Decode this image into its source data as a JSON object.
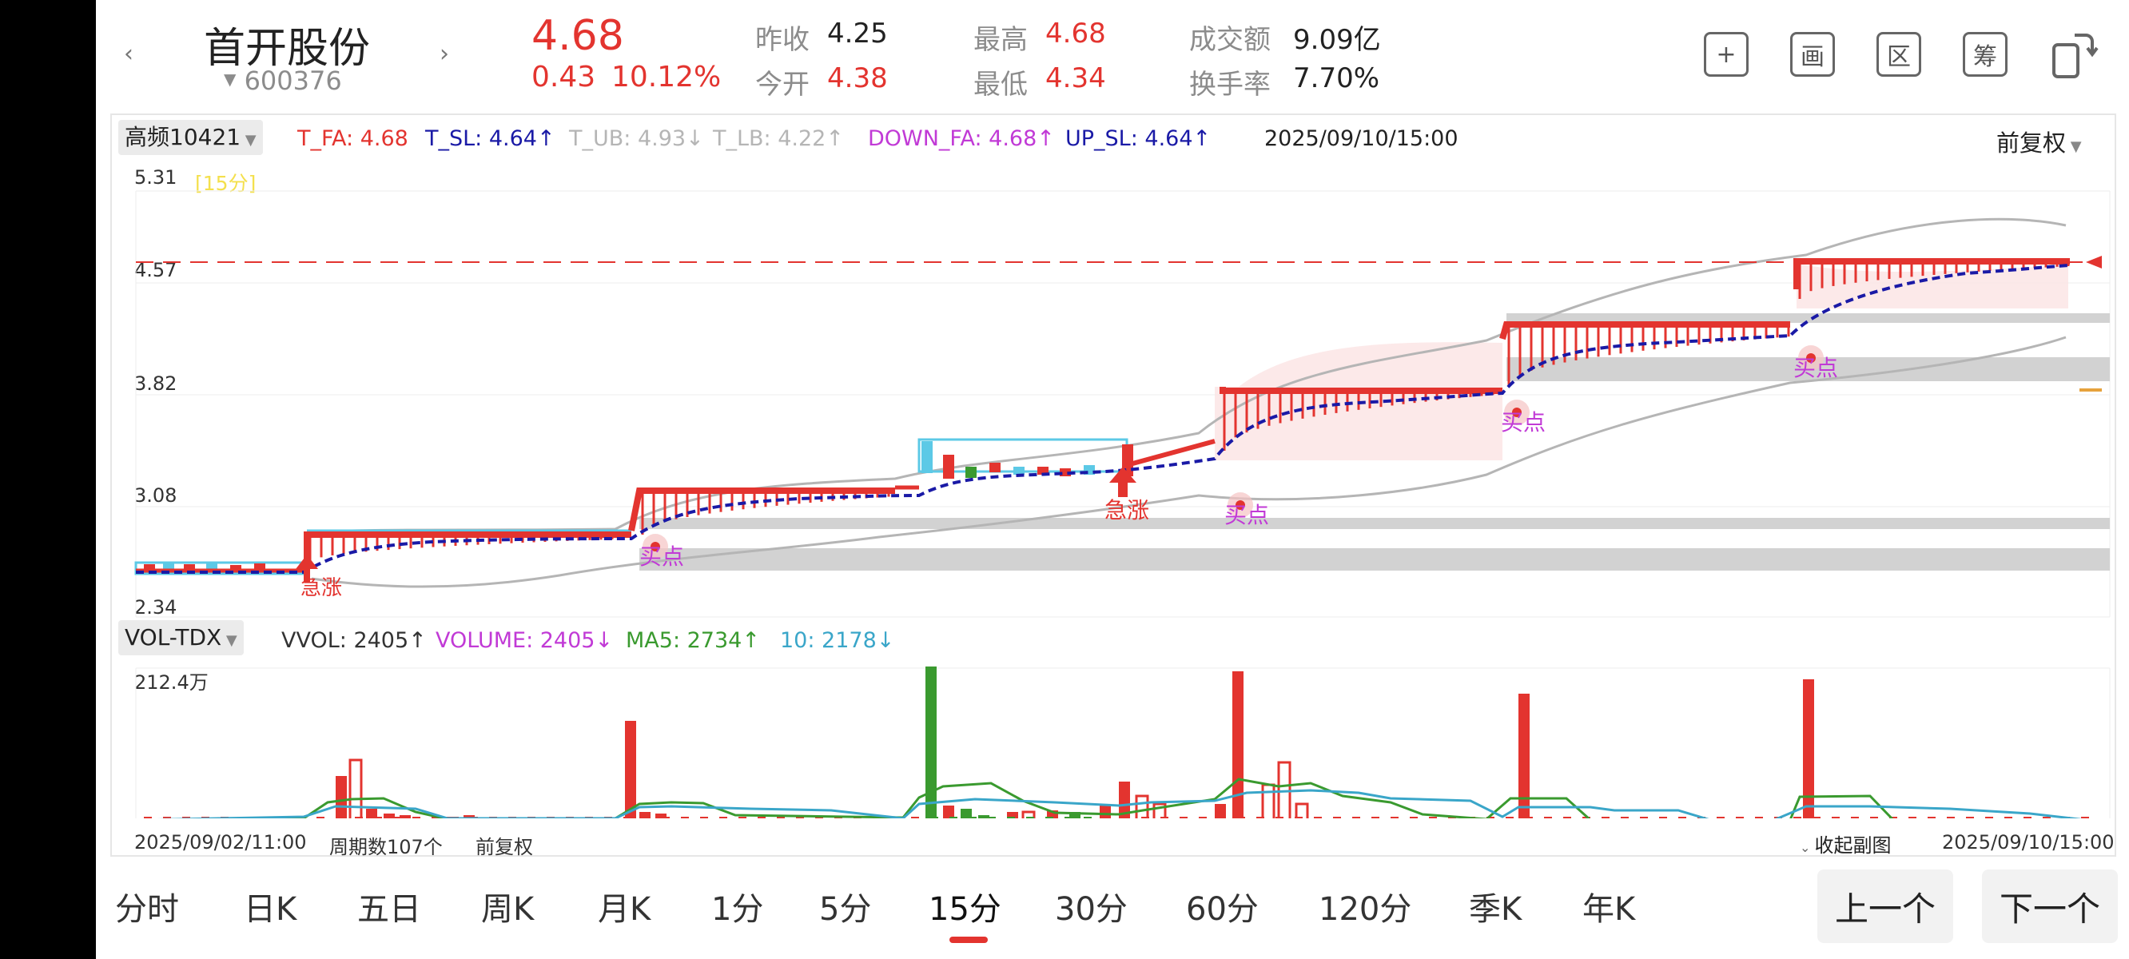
{
  "stock": {
    "name": "首开股份",
    "code": "600376",
    "price": "4.68",
    "change": "0.43",
    "change_pct": "10.12%"
  },
  "quote": {
    "prev_close_label": "昨收",
    "prev_close": "4.25",
    "open_label": "今开",
    "open": "4.38",
    "high_label": "最高",
    "high": "4.68",
    "low_label": "最低",
    "low": "4.34",
    "amount_label": "成交额",
    "amount": "9.09亿",
    "turnover_label": "换手率",
    "turnover": "7.70%"
  },
  "toolbar": {
    "plus_glyph": "+",
    "pic_glyph": "画",
    "range_glyph": "区",
    "chip_glyph": "筹"
  },
  "main_indicator": {
    "name": "高频10421",
    "items": [
      {
        "label": "T_FA: 4.68",
        "color": "#e3342f"
      },
      {
        "label": "T_SL: 4.64↑",
        "color": "#1a1aa6"
      },
      {
        "label": "T_UB: 4.93↓",
        "color": "#b5b5b5"
      },
      {
        "label": "T_LB: 4.22↑",
        "color": "#b5b5b5"
      },
      {
        "label": "DOWN_FA: 4.68↑",
        "color": "#c13ad6"
      },
      {
        "label": "UP_SL: 4.64↑",
        "color": "#1a1aa6"
      }
    ],
    "timestamp": "2025/09/10/15:00",
    "adjust": "前复权",
    "period_badge": "[15分]",
    "price_levels": [
      "5.31",
      "4.57",
      "3.82",
      "3.08",
      "2.34"
    ],
    "signals": {
      "jizhang": "急涨",
      "maidian": "买点"
    }
  },
  "vol_indicator": {
    "name": "VOL-TDX",
    "items": [
      {
        "label": "VVOL: 2405↑",
        "color": "#333333"
      },
      {
        "label": "VOLUME: 2405↓",
        "color": "#c13ad6"
      },
      {
        "label": "MA5: 2734↑",
        "color": "#3a9a2f"
      },
      {
        "label": "10: 2178↓",
        "color": "#3aa6c9"
      }
    ],
    "max_label": "212.4万"
  },
  "footer": {
    "start": "2025/09/02/11:00",
    "periods": "周期数107个",
    "adjust": "前复权",
    "collapse": "收起副图",
    "end": "2025/09/10/15:00"
  },
  "tabs": [
    "分时",
    "日K",
    "五日",
    "周K",
    "月K",
    "1分",
    "5分",
    "15分",
    "30分",
    "60分",
    "120分",
    "季K",
    "年K"
  ],
  "nav": {
    "prev": "上一个",
    "next": "下一个"
  },
  "chart_data": {
    "type": "candlestick",
    "timeframe": "15分",
    "ylim": [
      2.34,
      5.31
    ],
    "segments": [
      {
        "T_FA": 2.72,
        "T_SL": 2.7
      },
      {
        "T_FA": 2.98,
        "T_SL": 2.95
      },
      {
        "T_FA": 3.27,
        "T_SL": 3.23
      },
      {
        "T_FA": 3.48,
        "T_SL": 3.45
      },
      {
        "T_FA": 3.84,
        "T_SL": 3.8
      },
      {
        "T_FA": 4.24,
        "T_SL": 4.2
      },
      {
        "T_FA": 4.68,
        "T_SL": 4.64
      }
    ],
    "last_close": 4.68,
    "volume_max": 2124000
  }
}
